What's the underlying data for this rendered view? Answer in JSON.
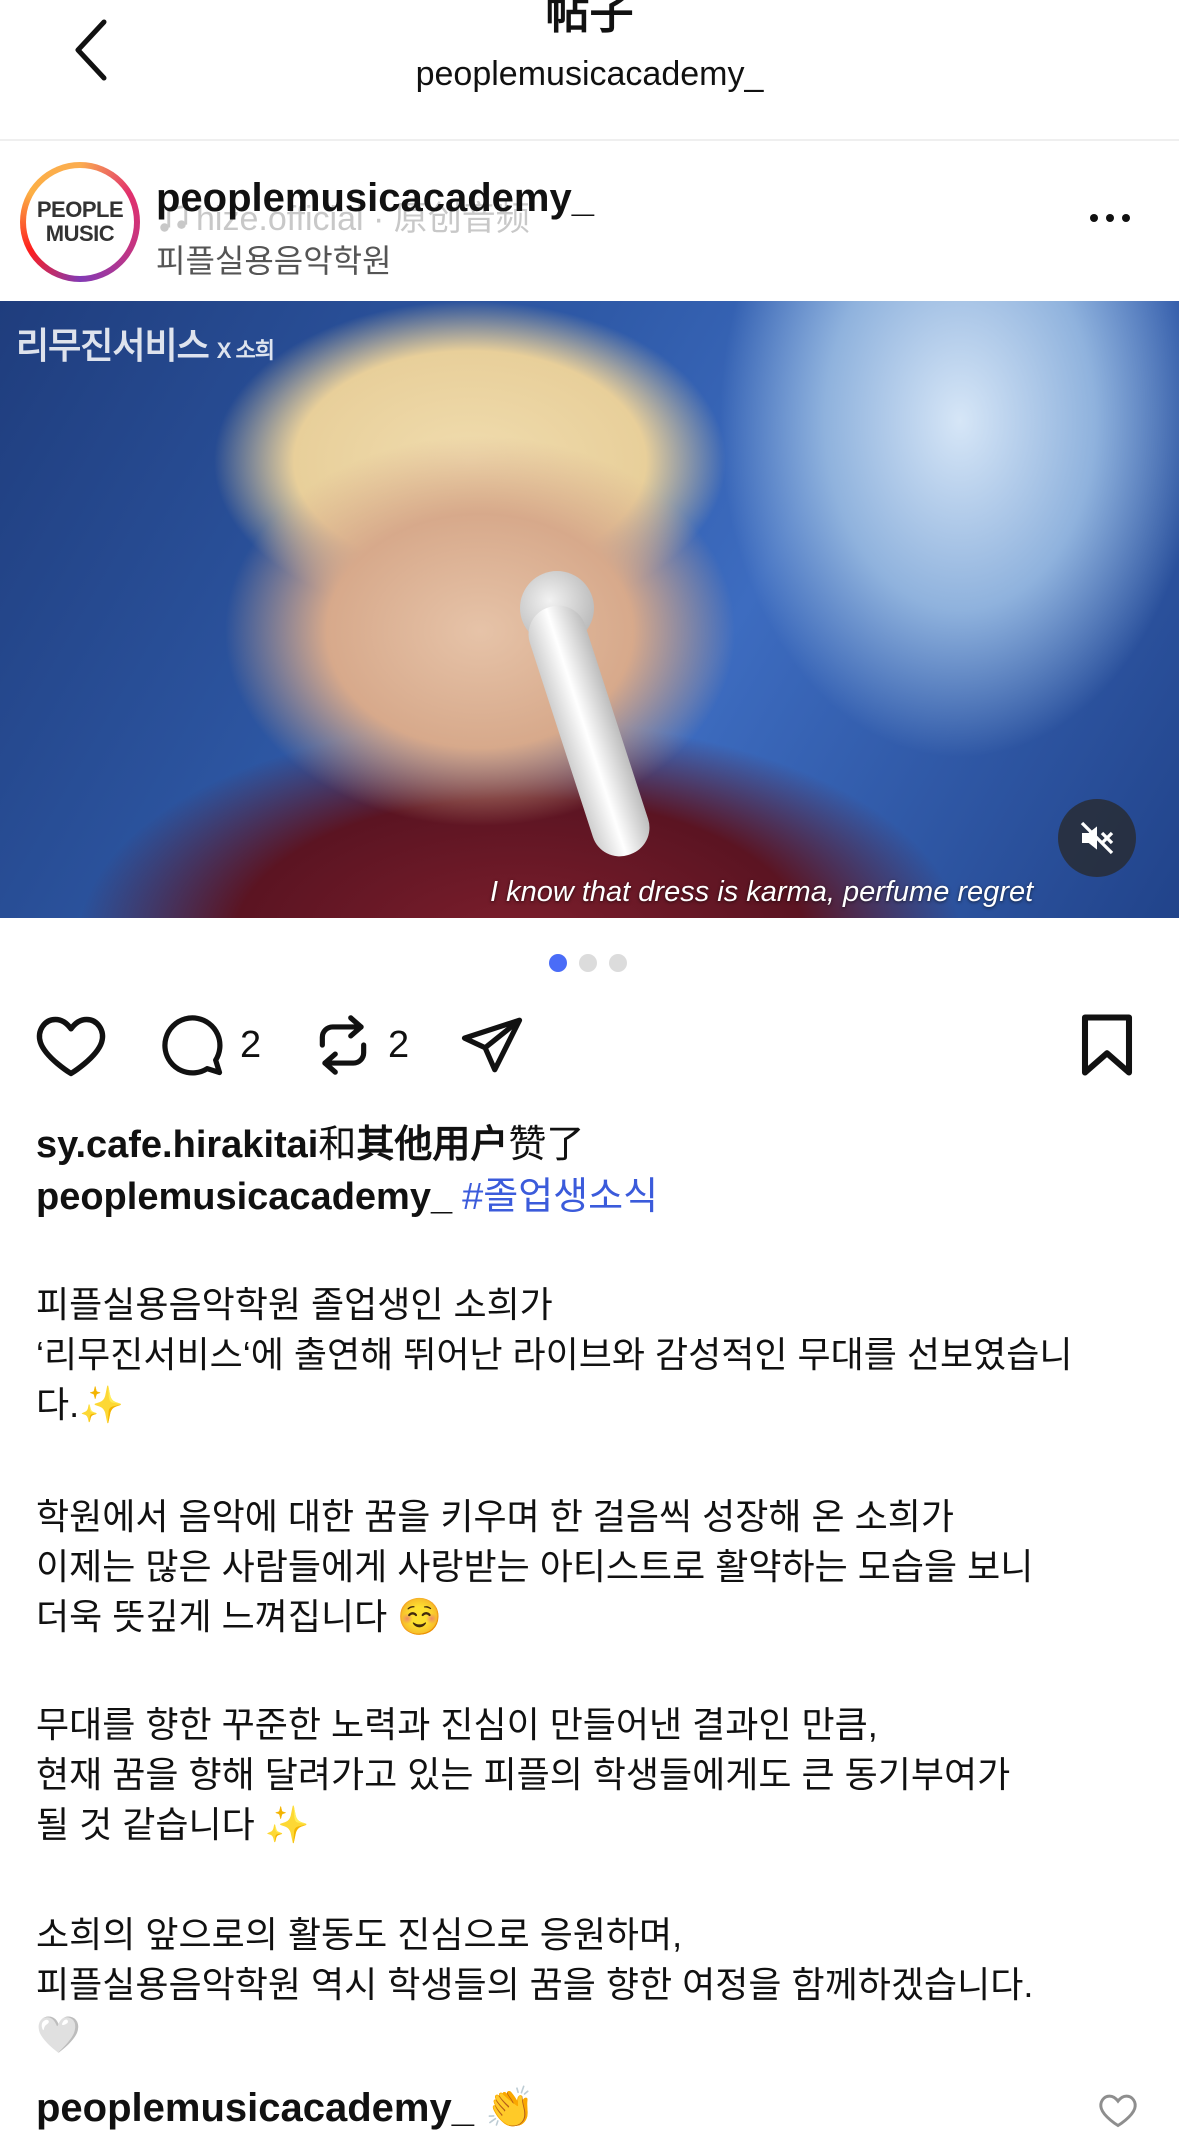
{
  "header": {
    "title": "帖子",
    "subtitle": "peoplemusicacademy_"
  },
  "post": {
    "avatar_lines": [
      "PEOPLE",
      "MUSIC"
    ],
    "username": "peoplemusicacademy_",
    "audio": "hize.official · 原创音频",
    "location": "피플실용음악학원",
    "media": {
      "logo": "리무진서비스",
      "logo_sub": "X 소희",
      "subtitle": "I know that dress is karma, perfume regret",
      "carousel_count": 3,
      "carousel_active": 1
    },
    "actions": {
      "comment_count": "2",
      "repost_count": "2"
    },
    "likes_user": "sy.cafe.hirakitai",
    "likes_join": "和",
    "likes_others": "其他用户",
    "likes_suffix": "赞了",
    "caption_user": "peoplemusicacademy_",
    "caption_hashtag": "#졸업생소식",
    "paragraphs": [
      "피플실용음악학원 졸업생인 소희가\n‘리무진서비스‘에 출연해 뛰어난 라이브와 감성적인 무대를 선보였습니다.✨",
      "학원에서 음악에 대한 꿈을 키우며 한 걸음씩 성장해 온 소희가\n이제는 많은 사람들에게 사랑받는 아티스트로 활약하는 모습을 보니\n더욱 뜻깊게 느껴집니다 ☺️",
      "무대를 향한 꾸준한 노력과 진심이 만들어낸 결과인 만큼,\n현재 꿈을 향해 달려가고 있는 피플의 학생들에게도 큰 동기부여가\n될 것 같습니다 ✨",
      "소희의 앞으로의 활동도 진심으로 응원하며,\n피플실용음악학원 역시 학생들의 꿈을 향한 여정을 함께하겠습니다.\n🤍"
    ]
  },
  "comment": {
    "username": "peoplemusicacademy_",
    "text": "👏"
  },
  "colors": {
    "hashtag": "#3b5bdb",
    "carousel_active": "#4a6cf7"
  }
}
